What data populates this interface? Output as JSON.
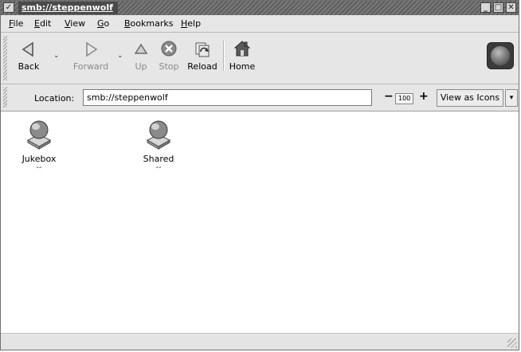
{
  "window": {
    "title": "smb://steppenwolf",
    "window_menu_glyph": "✓",
    "minimize_glyph": "_",
    "maximize_glyph": "□",
    "close_glyph": "✕"
  },
  "menu": {
    "items": [
      "File",
      "Edit",
      "View",
      "Go",
      "Bookmarks",
      "Help"
    ]
  },
  "toolbar": {
    "back_label": "Back",
    "forward_label": "Forward",
    "up_label": "Up",
    "stop_label": "Stop",
    "reload_label": "Reload",
    "home_label": "Home",
    "dropdown_glyph": "⌄"
  },
  "location": {
    "label": "Location:",
    "value": "smb://steppenwolf"
  },
  "zoom": {
    "minus_glyph": "−",
    "value": "100",
    "plus_glyph": "+"
  },
  "view": {
    "label": "View as Icons",
    "arrow_glyph": "▾"
  },
  "files": [
    {
      "name": "Jukebox",
      "info": "--"
    },
    {
      "name": "Shared",
      "info": "--"
    }
  ],
  "colors": {
    "titlebar": "#5e5e5e",
    "background": "#e6e6e6",
    "content": "#ffffff",
    "stop_icon": "#8a8a8a"
  },
  "icons": {
    "back": "back-arrow-icon",
    "forward": "forward-arrow-icon",
    "up": "up-arrow-icon",
    "stop": "stop-icon",
    "reload": "reload-icon",
    "home": "home-icon",
    "share": "network-share-icon"
  }
}
